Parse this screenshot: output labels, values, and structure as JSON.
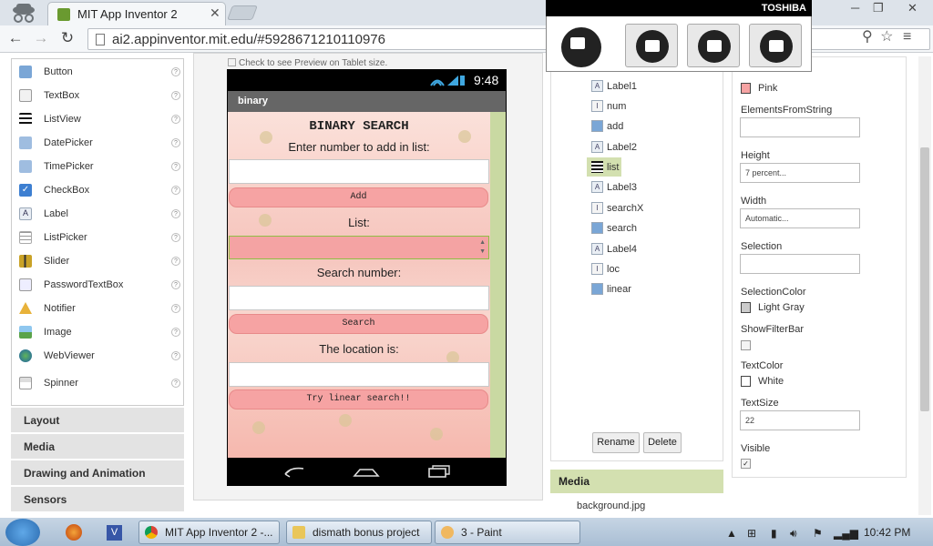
{
  "browser": {
    "tab_title": "MIT App Inventor 2",
    "url": "ai2.appinventor.mit.edu/#5928671210110976"
  },
  "palette": {
    "items": [
      "Button",
      "TextBox",
      "ListView",
      "DatePicker",
      "TimePicker",
      "CheckBox",
      "Label",
      "ListPicker",
      "Slider",
      "PasswordTextBox",
      "Notifier",
      "Image",
      "WebViewer",
      "Spinner"
    ],
    "categories": [
      "Layout",
      "Media",
      "Drawing and Animation",
      "Sensors"
    ]
  },
  "viewer": {
    "tablet_check": "Check to see Preview on Tablet size.",
    "clock": "9:48",
    "screen_title": "binary",
    "heading": "BINARY SEARCH",
    "label1": "Enter number to add in list:",
    "add_button": "Add",
    "label2": "List:",
    "label3": "Search number:",
    "search_button": "Search",
    "label4": "The location is:",
    "linear_button": "Try linear search!!"
  },
  "components": {
    "items": [
      "Label1",
      "num",
      "add",
      "Label2",
      "list",
      "Label3",
      "searchX",
      "search",
      "Label4",
      "loc",
      "linear"
    ],
    "rename": "Rename",
    "delete": "Delete",
    "media_header": "Media",
    "media_file": "background.jpg"
  },
  "properties": {
    "bgcolor_value": "Pink",
    "efs_label": "ElementsFromString",
    "efs_value": "",
    "height_label": "Height",
    "height_value": "7 percent...",
    "width_label": "Width",
    "width_value": "Automatic...",
    "selection_label": "Selection",
    "selection_value": "",
    "selcolor_label": "SelectionColor",
    "selcolor_value": "Light Gray",
    "showfilter_label": "ShowFilterBar",
    "textcolor_label": "TextColor",
    "textcolor_value": "White",
    "textsize_label": "TextSize",
    "textsize_value": "22",
    "visible_label": "Visible",
    "visible_check": "✓"
  },
  "toshiba": {
    "brand": "TOSHIBA"
  },
  "taskbar": {
    "items": [
      "MIT App Inventor 2 -...",
      "dismath bonus project",
      "3 - Paint"
    ],
    "time": "10:42 PM"
  },
  "colors": {
    "pink": "#f6a3a3",
    "green": "#d3e0b0"
  }
}
